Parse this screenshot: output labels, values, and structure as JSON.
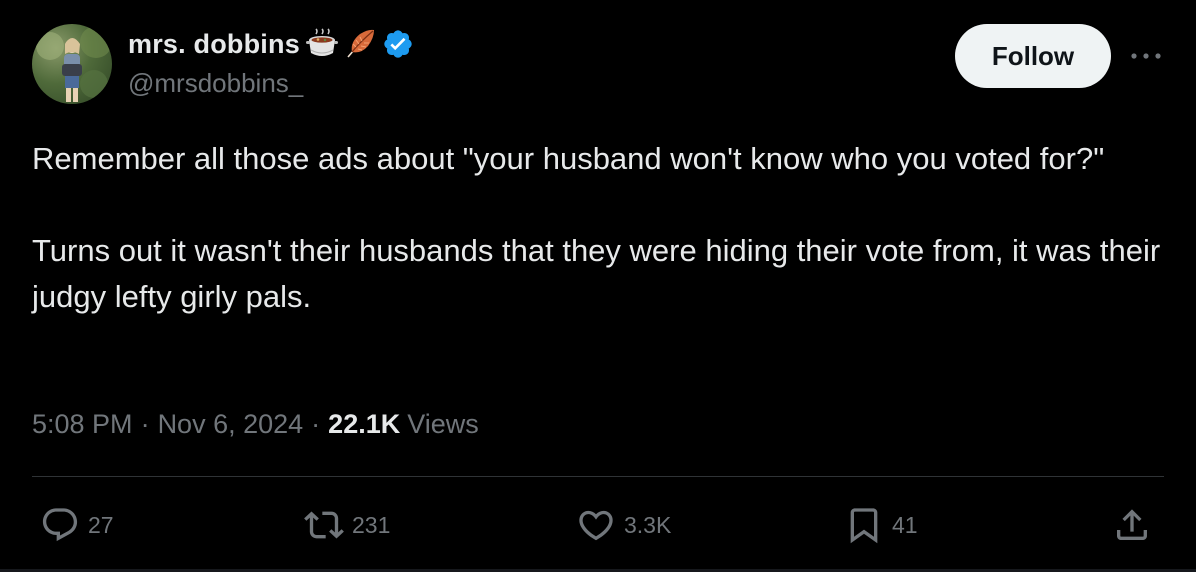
{
  "author": {
    "display_name": "mrs. dobbins",
    "handle": "@mrsdobbins_",
    "emojis": [
      "pot-of-food-emoji",
      "feather-emoji"
    ],
    "verified_badge": "verified-badge-icon",
    "verified_color": "#1d9bf0"
  },
  "follow_button": {
    "label": "Follow"
  },
  "more_icon": "more-horizontal-icon",
  "tweet": {
    "text": "Remember all those ads about \"your husband won't know who you voted for?\"\n\nTurns out it wasn't their husbands that they were hiding their vote from, it was their judgy lefty girly pals.",
    "time": "5:08 PM",
    "separator": "·",
    "date": "Nov 6, 2024",
    "views_count": "22.1K",
    "views_label": "Views"
  },
  "actions": {
    "reply": {
      "icon": "reply-icon",
      "count": "27"
    },
    "retweet": {
      "icon": "retweet-icon",
      "count": "231"
    },
    "like": {
      "icon": "heart-icon",
      "count": "3.3K"
    },
    "bookmark": {
      "icon": "bookmark-icon",
      "count": "41"
    },
    "share": {
      "icon": "share-icon"
    }
  },
  "colors": {
    "background": "#000000",
    "text_primary": "#e7e9ea",
    "text_secondary": "#71767b",
    "divider": "#2f3336",
    "follow_bg": "#eff3f4"
  }
}
